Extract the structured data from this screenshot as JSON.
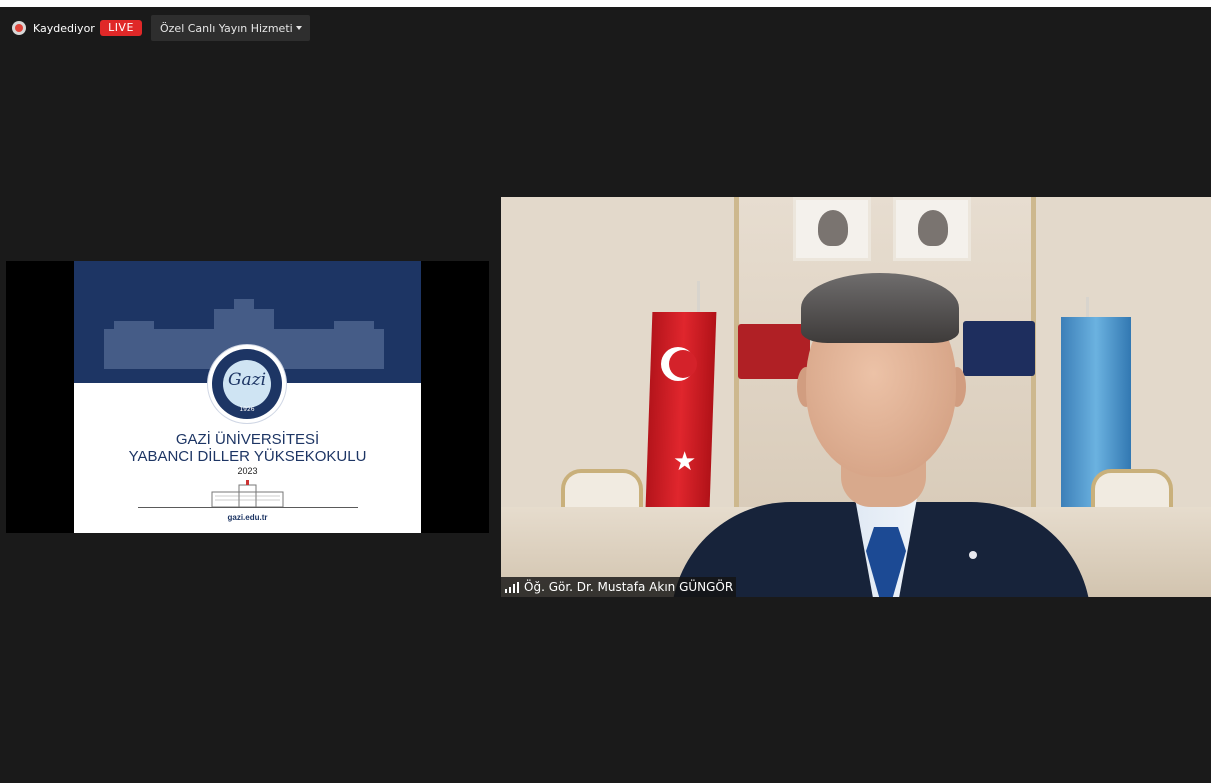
{
  "status_bar": {
    "recording_label": "Kaydediyor",
    "live_badge": "LIVE",
    "live_service": "Özel Canlı Yayın Hizmeti"
  },
  "shared_screen": {
    "seal_year": "1926",
    "title_line1": "GAZİ ÜNİVERSİTESİ",
    "title_line2": "YABANCI DİLLER YÜKSEKOKULU",
    "year": "2023",
    "footer": "gazi.edu.tr"
  },
  "video": {
    "participant_name": "Öğ. Gör. Dr. Mustafa Akın GÜNGÖR",
    "signal_icon": "signal-strength-icon"
  },
  "colors": {
    "background": "#1a1a1a",
    "live_red": "#e02828",
    "slide_navy": "#1d3564"
  }
}
